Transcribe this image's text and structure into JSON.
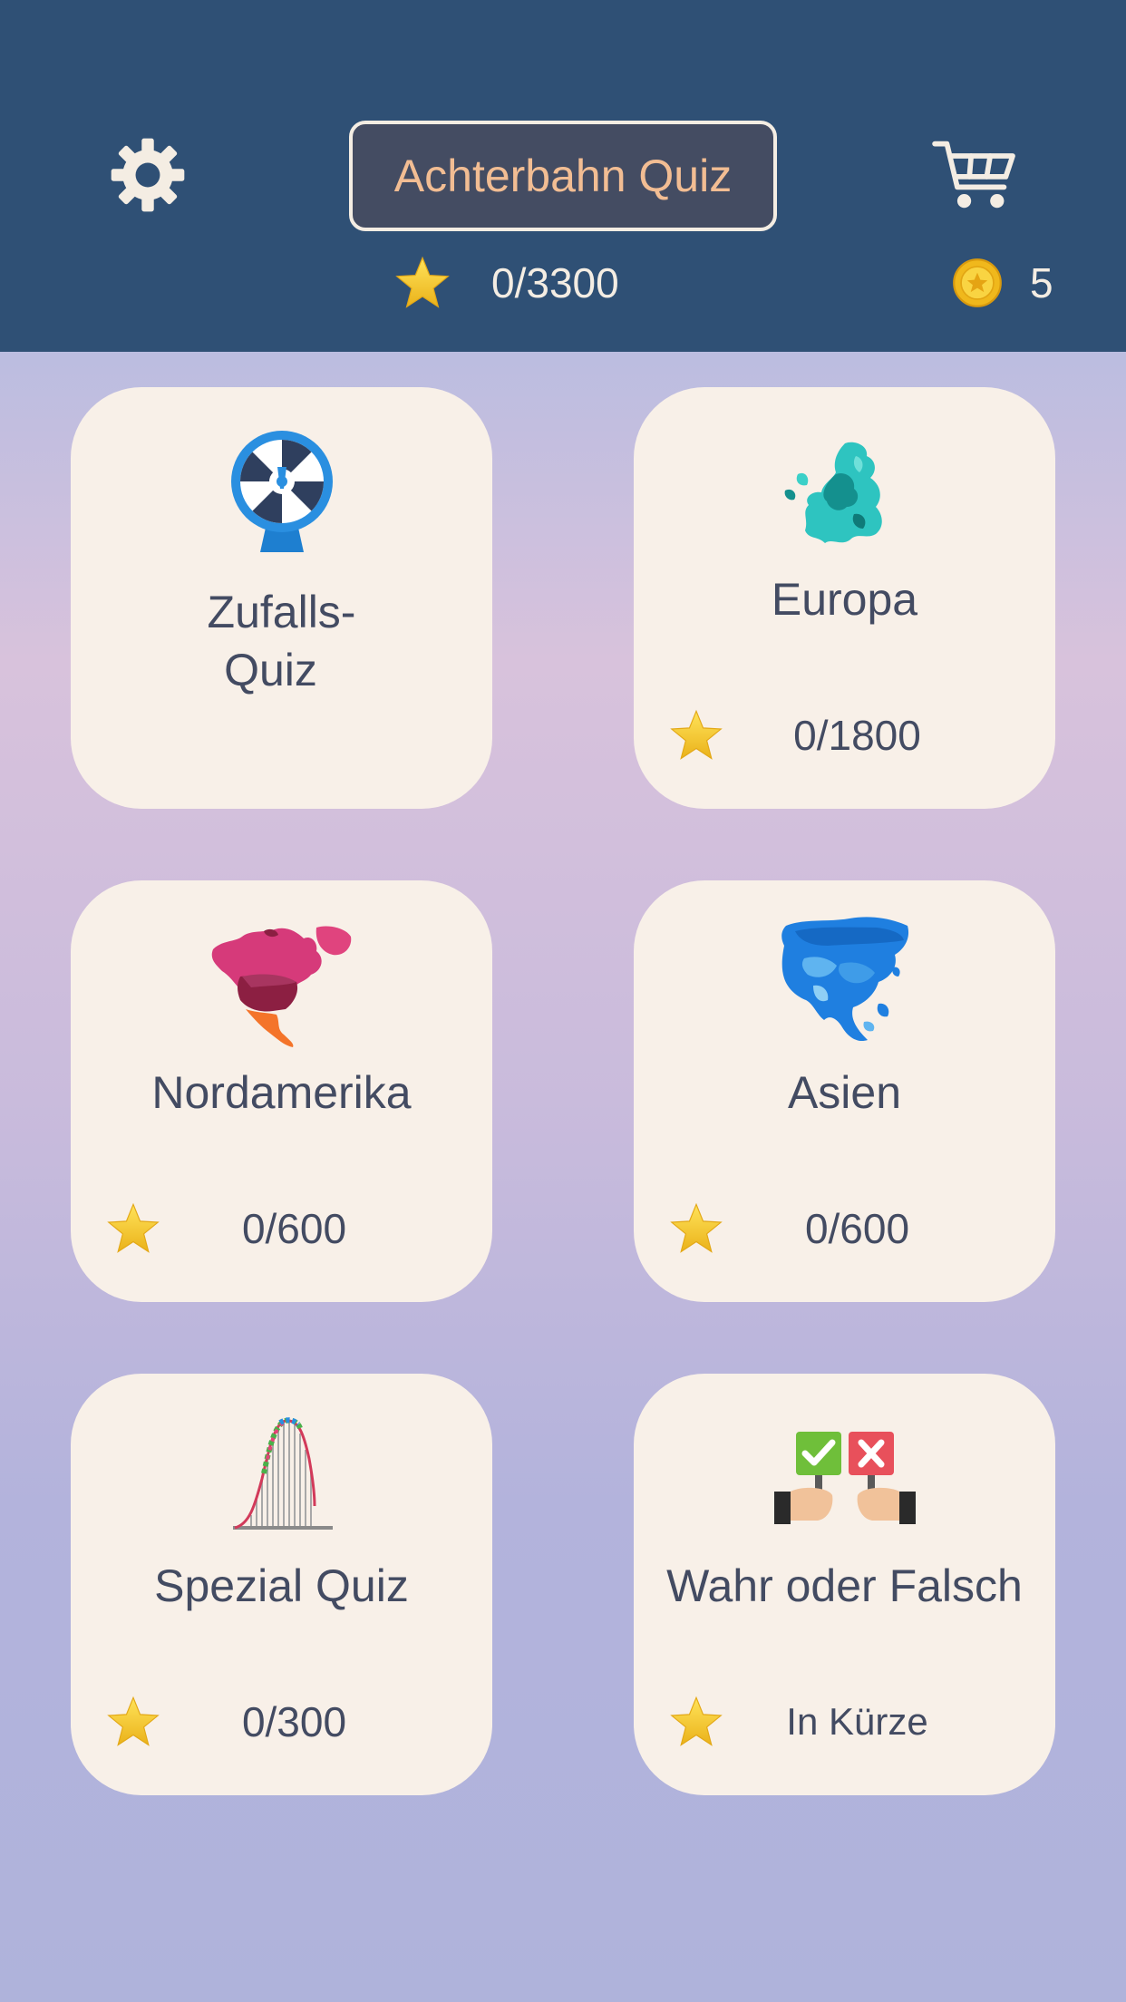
{
  "header": {
    "title": "Achterbahn Quiz",
    "total_progress": "0/3300",
    "coins": "5",
    "settings_icon": "gear-icon",
    "cart_icon": "cart-icon"
  },
  "colors": {
    "header_bg": "#2f5075",
    "title_text": "#f2bd93",
    "card_bg": "#f8f0e8",
    "card_text": "#434b62",
    "star": "#f2c72c"
  },
  "cards": [
    {
      "label_line1": "Zufalls-",
      "label_line2": "Quiz",
      "icon": "wheel-of-fortune-icon"
    },
    {
      "label": "Europa",
      "progress": "0/1800",
      "icon": "europe-map-icon"
    },
    {
      "label": "Nordamerika",
      "progress": "0/600",
      "icon": "north-america-map-icon"
    },
    {
      "label": "Asien",
      "progress": "0/600",
      "icon": "asia-map-icon"
    },
    {
      "label": "Spezial Quiz",
      "progress": "0/300",
      "icon": "roller-coaster-icon"
    },
    {
      "label": "Wahr oder Falsch",
      "progress": "In Kürze",
      "icon": "true-false-signs-icon"
    }
  ]
}
